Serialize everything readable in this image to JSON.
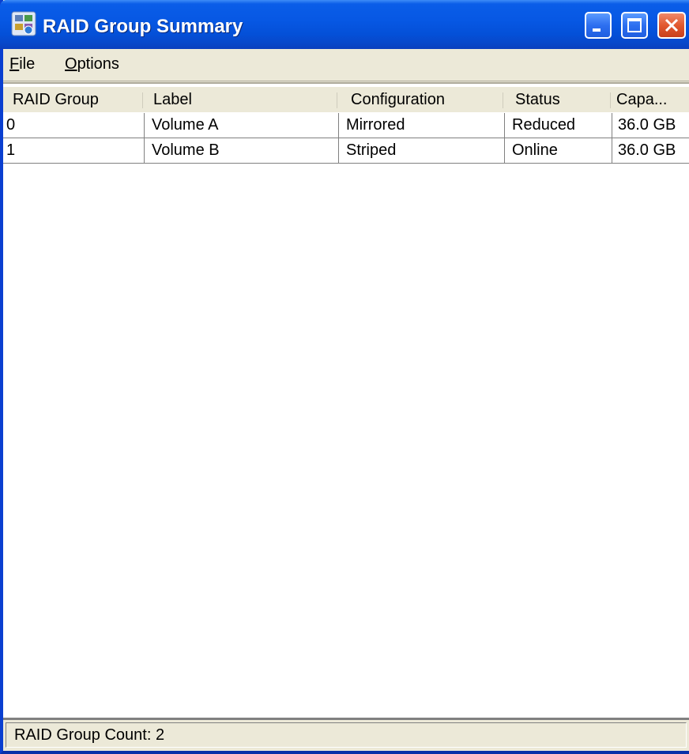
{
  "window": {
    "title": "RAID Group Summary",
    "app_icon": "raid-app-icon",
    "controls": {
      "minimize_icon": "minimize-icon",
      "maximize_icon": "maximize-icon",
      "close_icon": "close-icon"
    }
  },
  "menu": {
    "items": [
      {
        "label_mnemonic": "F",
        "label_rest": "ile"
      },
      {
        "label_mnemonic": "O",
        "label_rest": "ptions"
      }
    ]
  },
  "table": {
    "columns": [
      "RAID Group",
      "Label",
      "Configuration",
      "Status",
      "Capa..."
    ],
    "rows": [
      {
        "raid_group": "0",
        "label": "Volume A",
        "configuration": "Mirrored",
        "status": "Reduced",
        "capacity": "36.0 GB"
      },
      {
        "raid_group": "1",
        "label": "Volume B",
        "configuration": "Striped",
        "status": "Online",
        "capacity": "36.0 GB"
      }
    ]
  },
  "status_bar": {
    "text": "RAID Group Count: 2"
  },
  "colors": {
    "titlebar": "#0758e4",
    "chrome": "#ece9d8",
    "close_button": "#e2582e"
  }
}
